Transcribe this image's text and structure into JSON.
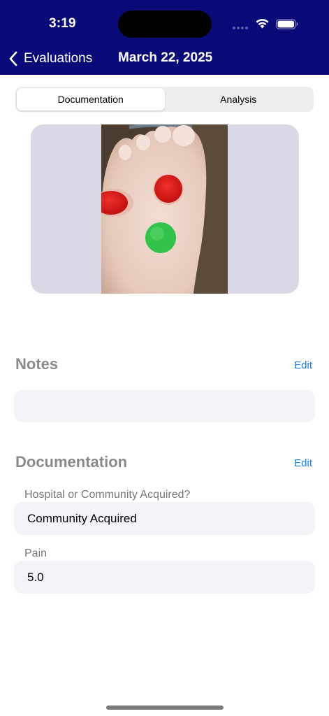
{
  "status_bar": {
    "time": "3:19"
  },
  "nav": {
    "back_label": "Evaluations",
    "title": "March 22, 2025"
  },
  "segments": [
    {
      "label": "Documentation",
      "selected": true
    },
    {
      "label": "Analysis",
      "selected": false
    }
  ],
  "notes": {
    "title": "Notes",
    "edit_label": "Edit",
    "value": ""
  },
  "documentation": {
    "title": "Documentation",
    "edit_label": "Edit",
    "fields": [
      {
        "label": "Hospital or Community Acquired?",
        "value": "Community Acquired"
      },
      {
        "label": "Pain",
        "value": "5.0"
      }
    ]
  },
  "colors": {
    "header": "#0a0a78",
    "accent": "#1a7ee3",
    "marker_red": "#e0201e",
    "marker_green": "#33c24a"
  }
}
